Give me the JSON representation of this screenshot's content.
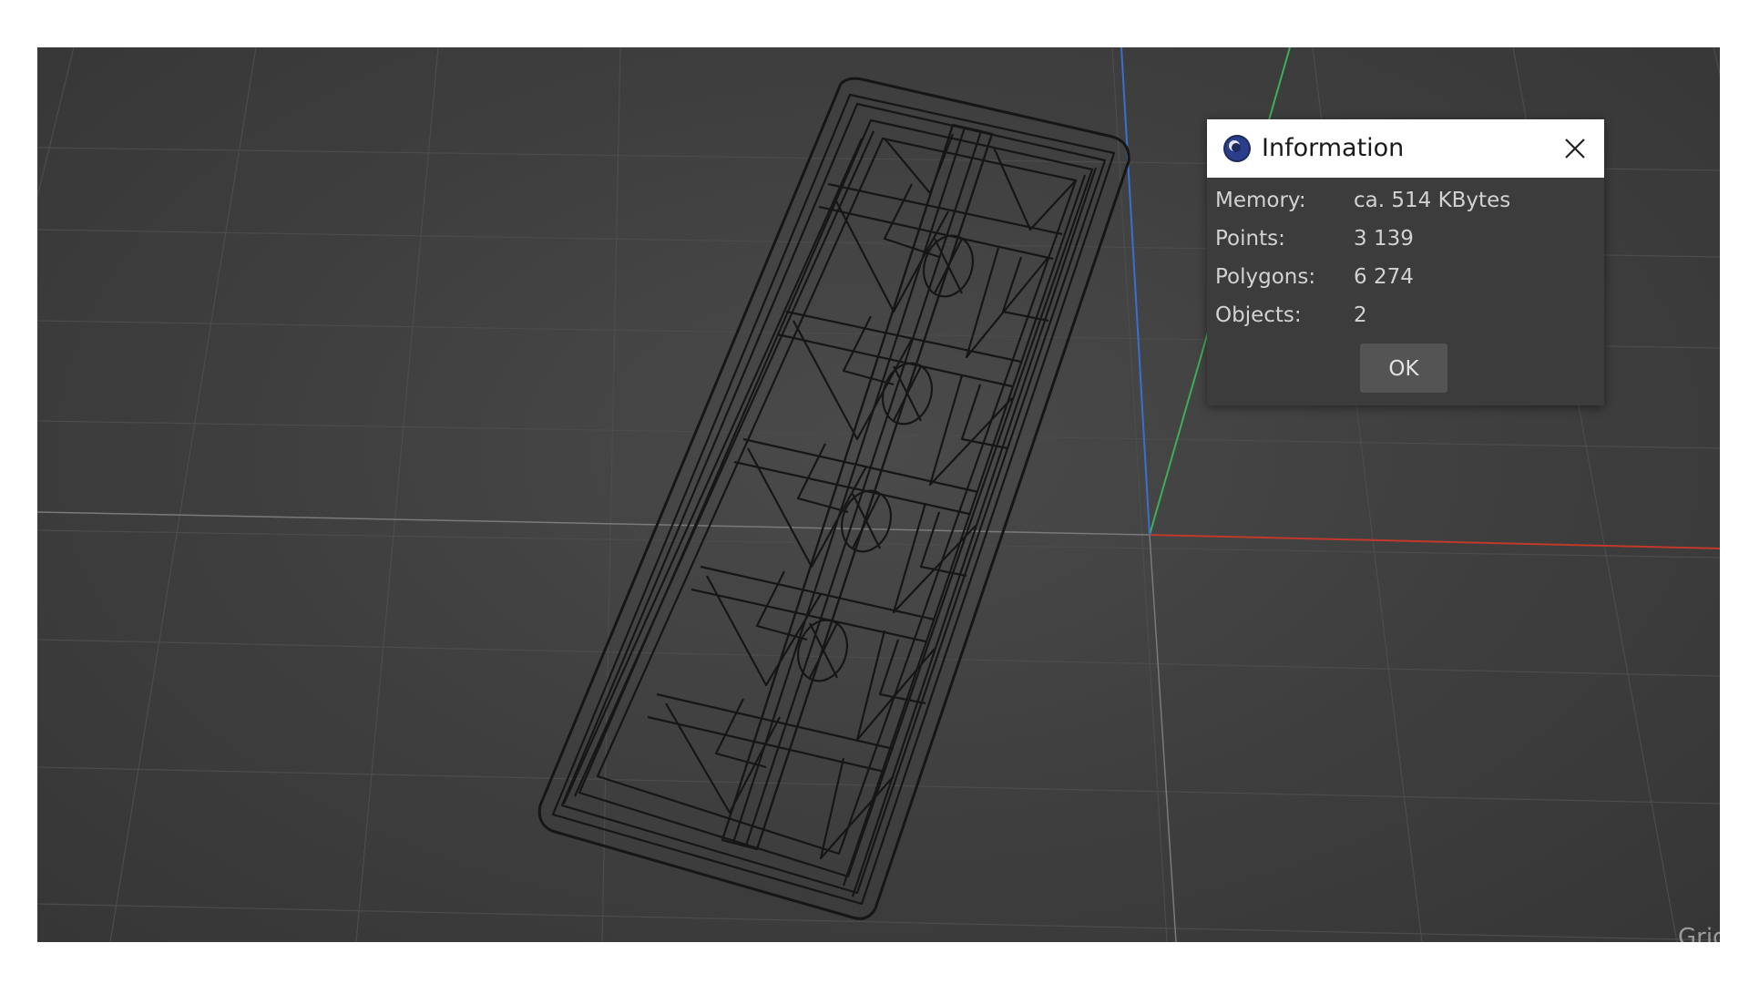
{
  "dialog": {
    "title": "Information",
    "app_icon": "cinema4d-logo-icon",
    "close_icon": "close-icon",
    "rows": [
      {
        "label": "Memory:",
        "value": "ca. 514 KBytes"
      },
      {
        "label": "Points:",
        "value": "3 139"
      },
      {
        "label": "Polygons:",
        "value": "6 274"
      },
      {
        "label": "Objects:",
        "value": "2"
      }
    ],
    "ok_label": "OK"
  },
  "viewport": {
    "corner_label": "Grid",
    "axis_colors": {
      "x": "#c0392b",
      "y": "#3fae58",
      "z": "#3a6fd1"
    },
    "background": "#3e3e3e"
  }
}
